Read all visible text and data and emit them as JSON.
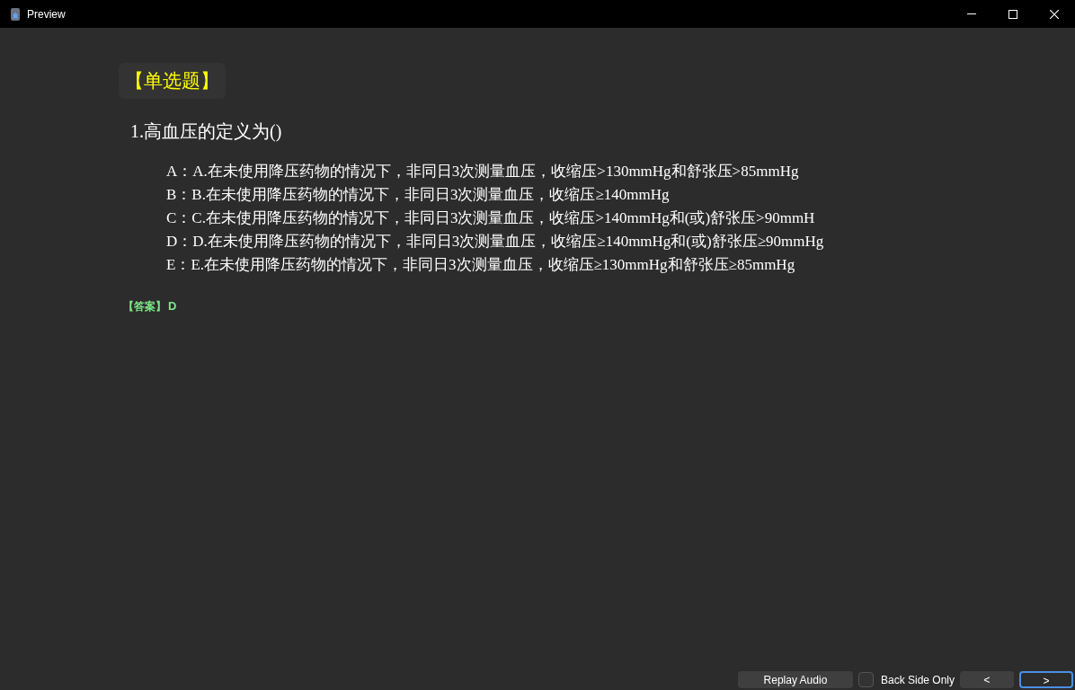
{
  "window": {
    "title": "Preview"
  },
  "question_type": "【单选题】",
  "question": "1.高血压的定义为()",
  "options": [
    {
      "label": "A：",
      "text": "A.在未使用降压药物的情况下，非同日3次测量血压，收缩压>130mmHg和舒张压>85mmHg"
    },
    {
      "label": "B：",
      "text": "B.在未使用降压药物的情况下，非同日3次测量血压，收缩压≥140mmHg"
    },
    {
      "label": "C：",
      "text": "C.在未使用降压药物的情况下，非同日3次测量血压，收缩压>140mmHg和(或)舒张压>90mmH"
    },
    {
      "label": "D：",
      "text": "D.在未使用降压药物的情况下，非同日3次测量血压，收缩压≥140mmHg和(或)舒张压≥90mmHg"
    },
    {
      "label": "E：",
      "text": "E.在未使用降压药物的情况下，非同日3次测量血压，收缩压≥130mmHg和舒张压≥85mmHg"
    }
  ],
  "answer": {
    "label": "【答案】",
    "value": "D"
  },
  "bottom_bar": {
    "replay_button": "Replay Audio",
    "back_side_only": {
      "label": "Back Side Only",
      "checked": false
    },
    "prev_button": "<",
    "next_button": ">"
  }
}
